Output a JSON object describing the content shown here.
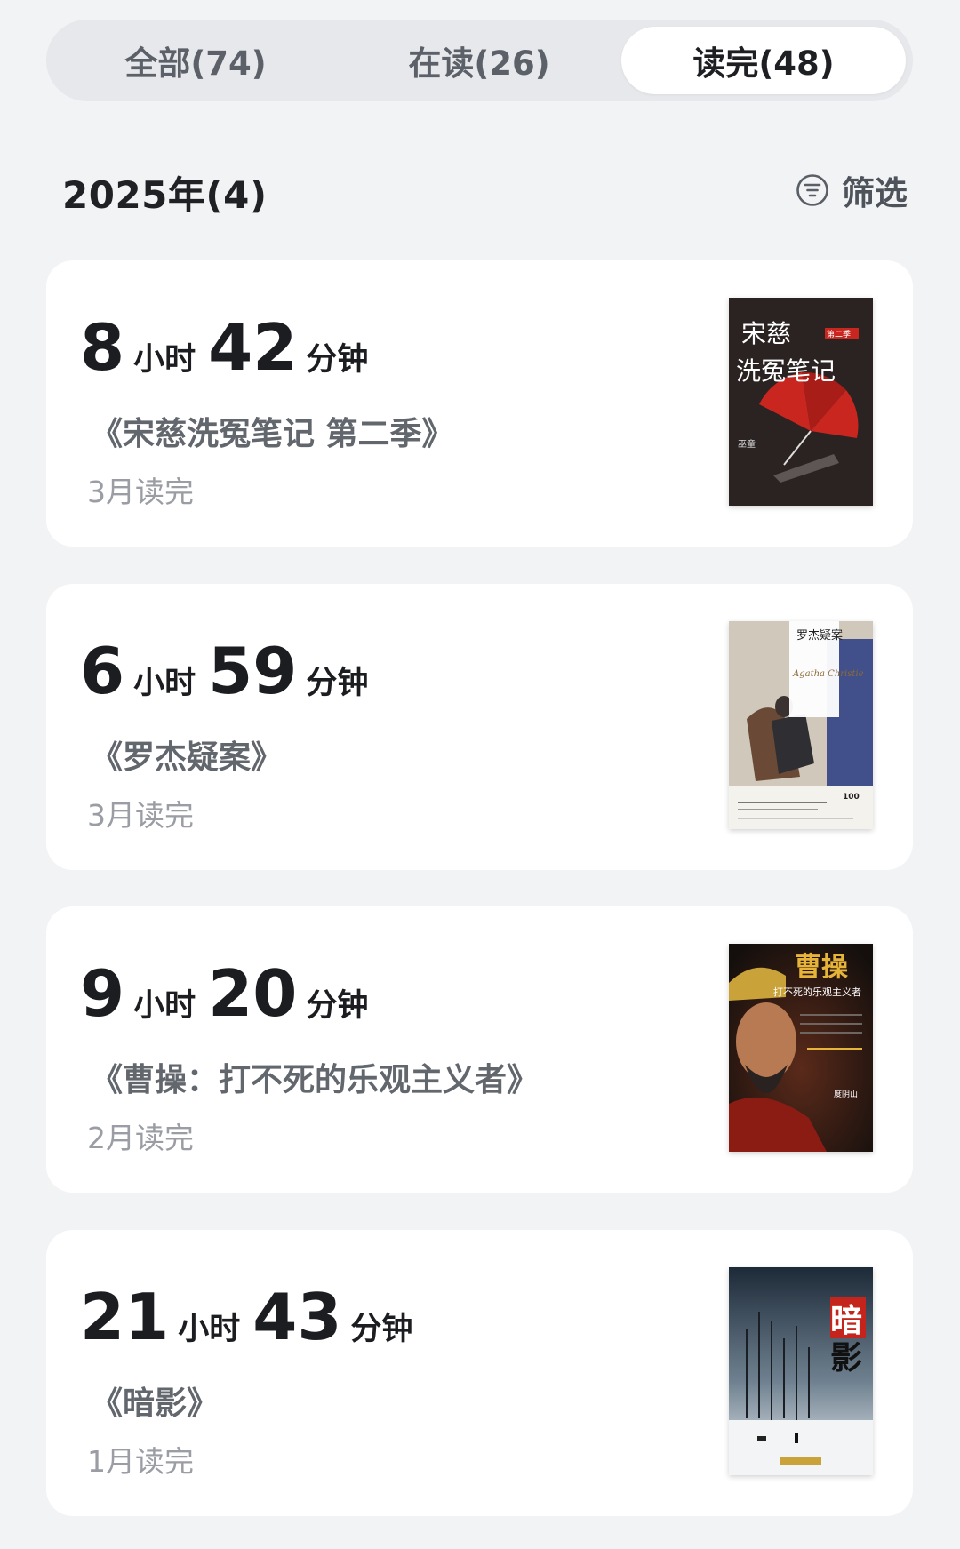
{
  "tabs": [
    {
      "label": "全部(74)",
      "active": false
    },
    {
      "label": "在读(26)",
      "active": false
    },
    {
      "label": "读完(48)",
      "active": true
    }
  ],
  "section": {
    "title": "2025年(4)",
    "filter_label": "筛选",
    "filter_icon": "filter-icon"
  },
  "units": {
    "hour": "小时",
    "minute": "分钟"
  },
  "books": [
    {
      "hours": "8",
      "minutes": "42",
      "title": "《宋慈洗冤笔记 第二季》",
      "finished": "3月读完",
      "cover": {
        "title": "宋慈洗冤笔记",
        "badge": "第二季",
        "author": "巫童",
        "colors": {
          "bg": "#2b2222",
          "accent": "#c8261f",
          "text": "#ffffff"
        }
      }
    },
    {
      "hours": "6",
      "minutes": "59",
      "title": "《罗杰疑案》",
      "finished": "3月读完",
      "cover": {
        "title": "罗杰疑案",
        "subtitle": "The Murder of Roger Ackroyd",
        "signature": "Agatha Christie",
        "badge": "100",
        "colors": {
          "bg": "#e6e2da",
          "accent": "#41508a",
          "text": "#222222"
        }
      }
    },
    {
      "hours": "9",
      "minutes": "20",
      "title": "《曹操：打不死的乐观主义者》",
      "finished": "2月读完",
      "cover": {
        "title": "曹操",
        "subtitle": "打不死的乐观主义者",
        "author": "度阴山",
        "colors": {
          "bg": "#1e1613",
          "accent": "#e7b43a",
          "text": "#ffffff"
        }
      }
    },
    {
      "hours": "21",
      "minutes": "43",
      "title": "《暗影》",
      "finished": "1月读完",
      "cover": {
        "title": "暗影",
        "colors": {
          "bg": "#cfd6dc",
          "accent": "#c5241c",
          "text": "#ffffff"
        }
      }
    }
  ]
}
